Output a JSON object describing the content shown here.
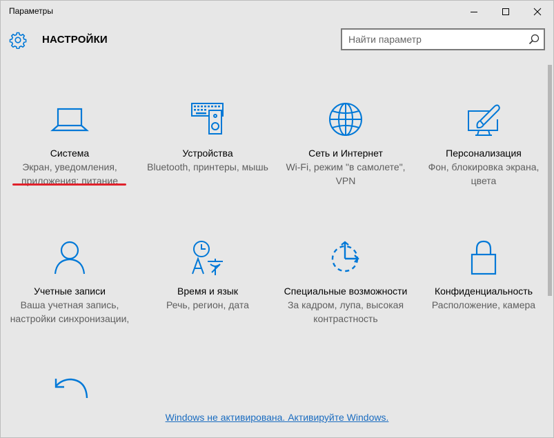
{
  "window": {
    "title": "Параметры"
  },
  "header": {
    "title": "НАСТРОЙКИ",
    "search_placeholder": "Найти параметр"
  },
  "tiles": [
    {
      "name": "Система",
      "desc": "Экран, уведомления, приложения; питание",
      "icon": "laptop-icon"
    },
    {
      "name": "Устройства",
      "desc": "Bluetooth, принтеры, мышь",
      "icon": "keyboard-speaker-icon"
    },
    {
      "name": "Сеть и Интернет",
      "desc": "Wi-Fi, режим \"в самолете\", VPN",
      "icon": "globe-icon"
    },
    {
      "name": "Персонализация",
      "desc": "Фон, блокировка экрана, цвета",
      "icon": "paint-icon"
    },
    {
      "name": "Учетные записи",
      "desc": "Ваша учетная запись, настройки синхронизации,",
      "icon": "person-icon"
    },
    {
      "name": "Время и язык",
      "desc": "Речь, регион, дата",
      "icon": "time-language-icon"
    },
    {
      "name": "Специальные возможности",
      "desc": "За кадром, лупа, высокая контрастность",
      "icon": "ease-of-access-icon"
    },
    {
      "name": "Конфиденциальность",
      "desc": "Расположение, камера",
      "icon": "lock-icon"
    }
  ],
  "footer": {
    "activation_text": "Windows не активирована. Активируйте Windows."
  },
  "colors": {
    "accent": "#0078d7",
    "background": "#e7e7e7",
    "annotation": "#e0212b",
    "link": "#1a6cc0"
  }
}
